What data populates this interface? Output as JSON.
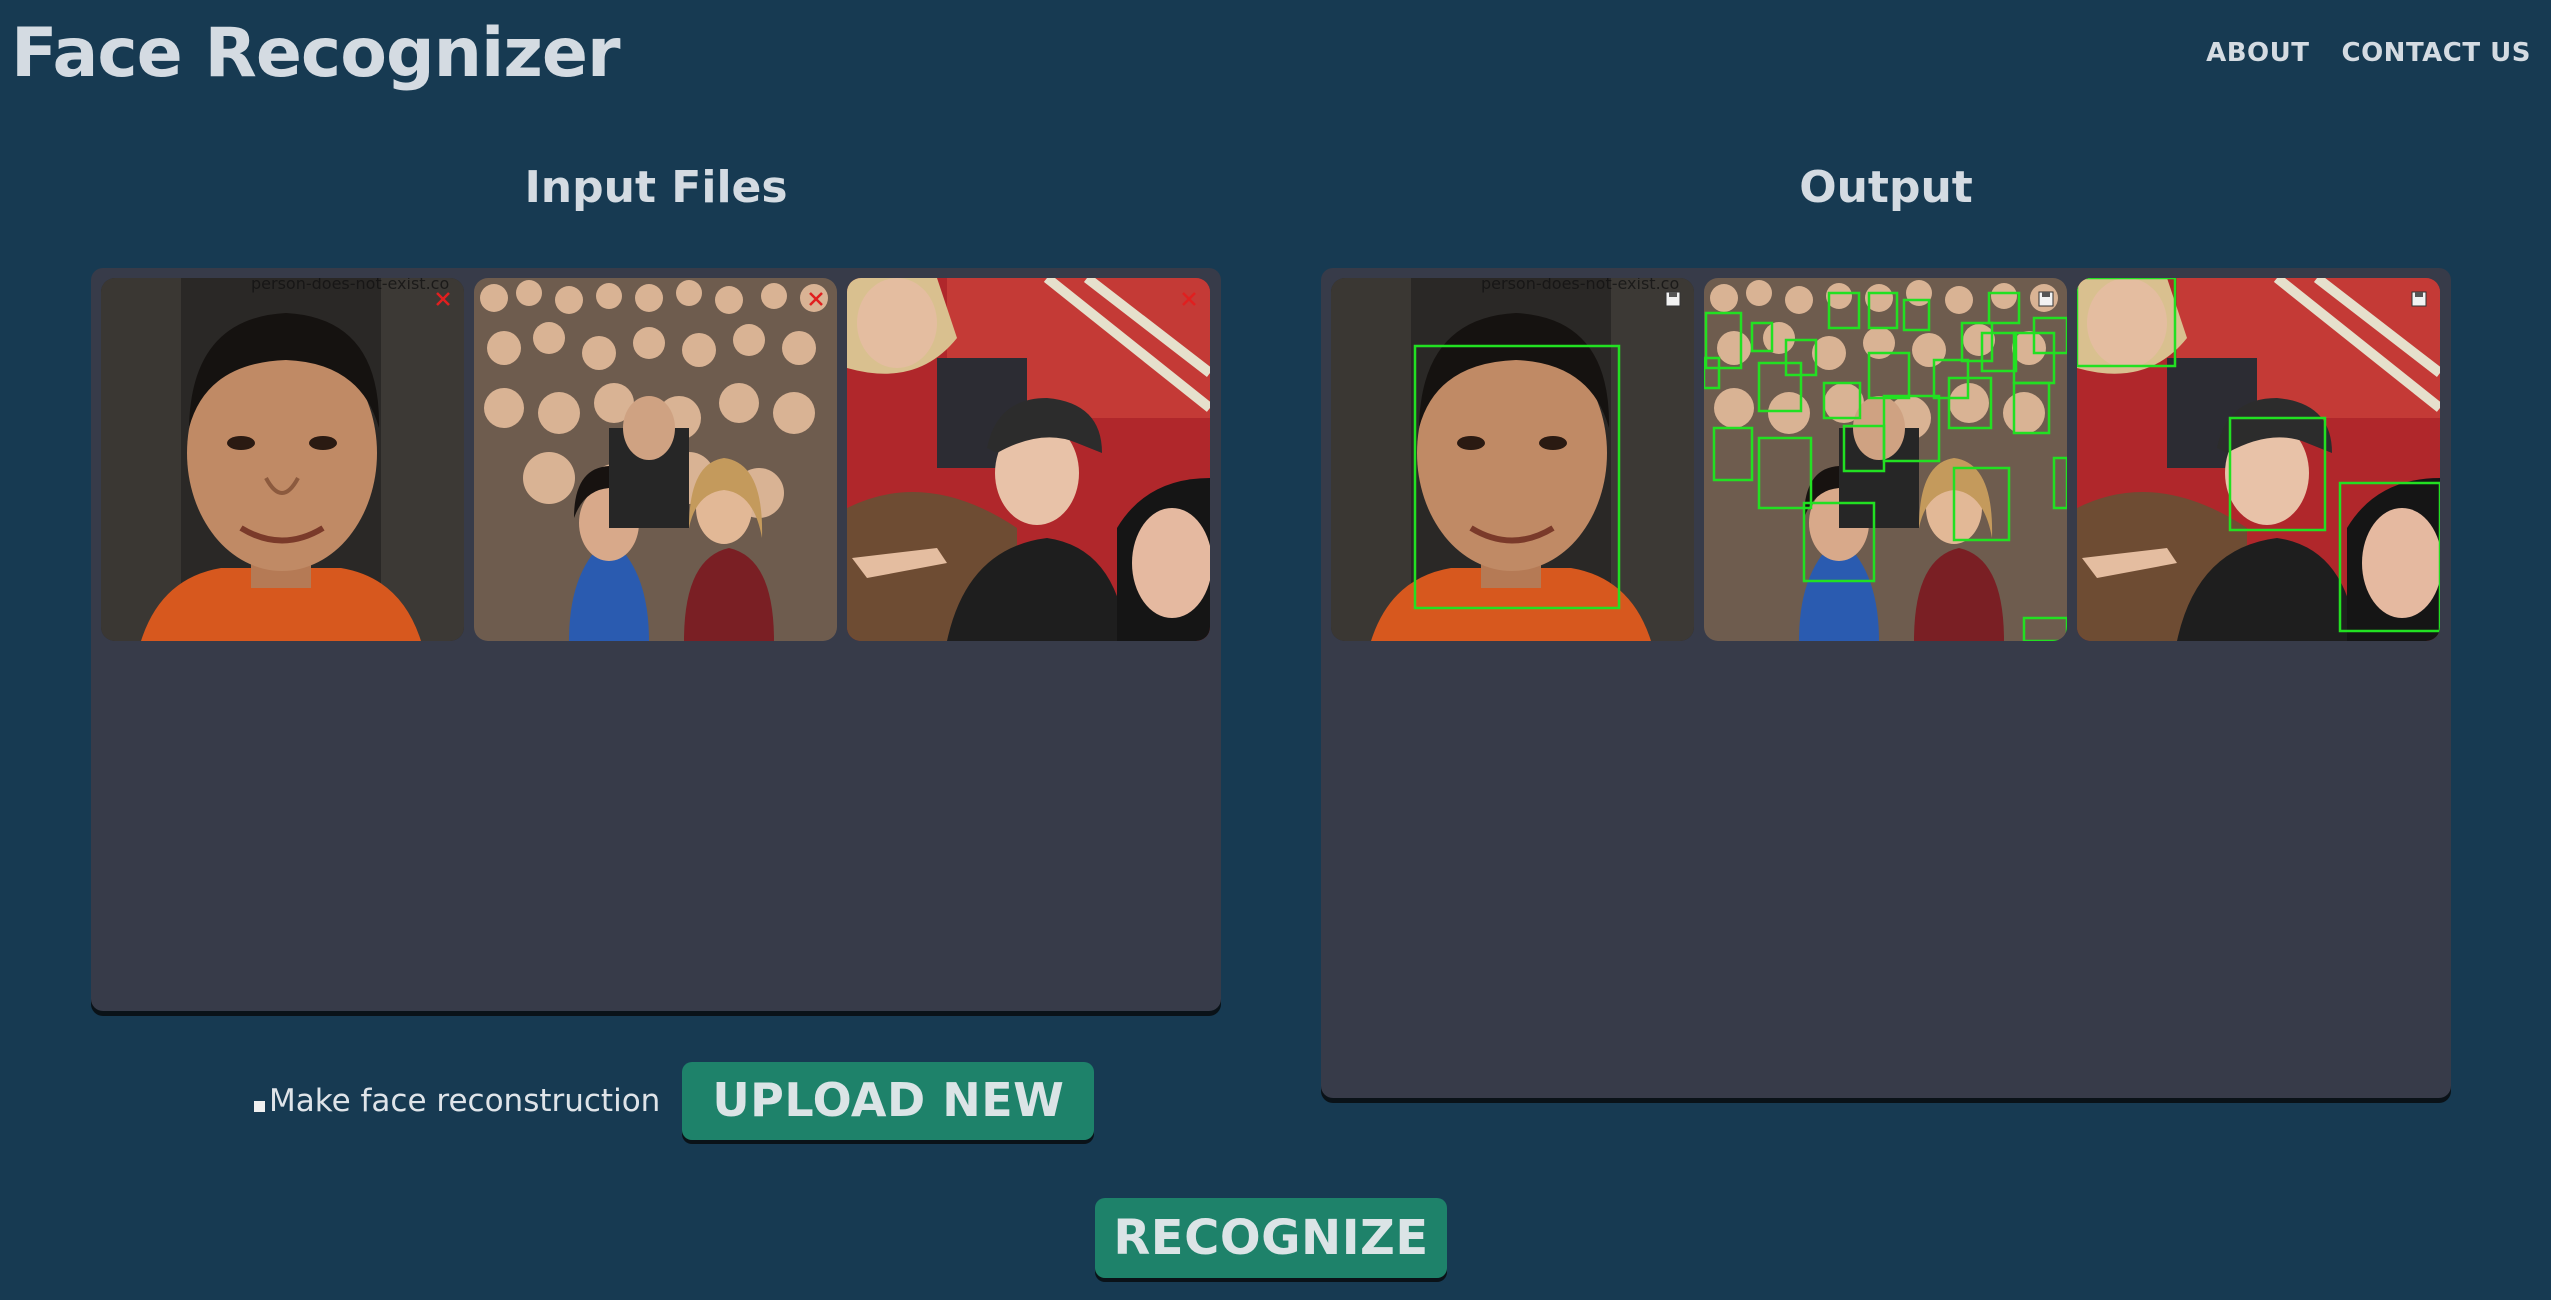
{
  "app": {
    "title": "Face Recognizer"
  },
  "nav": {
    "about": "ABOUT",
    "contact": "CONTACT US"
  },
  "input_section": {
    "title": "Input Files",
    "watermark": "person-does-not-exist.co",
    "images": [
      {
        "name": "portrait-man",
        "action_icon": "close-icon"
      },
      {
        "name": "crowd",
        "action_icon": "close-icon"
      },
      {
        "name": "selfie-group",
        "action_icon": "close-icon"
      }
    ]
  },
  "output_section": {
    "title": "Output",
    "watermark": "person-does-not-exist.co",
    "images": [
      {
        "name": "portrait-man-detected",
        "action_icon": "save-icon",
        "face_count": 1
      },
      {
        "name": "crowd-detected",
        "action_icon": "save-icon",
        "face_count": 26
      },
      {
        "name": "selfie-group-detected",
        "action_icon": "save-icon",
        "face_count": 3
      }
    ]
  },
  "controls": {
    "reconstruction_label": "Make face reconstruction",
    "reconstruction_checked": false,
    "upload_label": "UPLOAD NEW",
    "recognize_label": "RECOGNIZE"
  },
  "colors": {
    "background": "#173a52",
    "panel": "#373b49",
    "button": "#1e826a",
    "detection_box": "#22e022",
    "close_icon": "#e01f1f"
  }
}
